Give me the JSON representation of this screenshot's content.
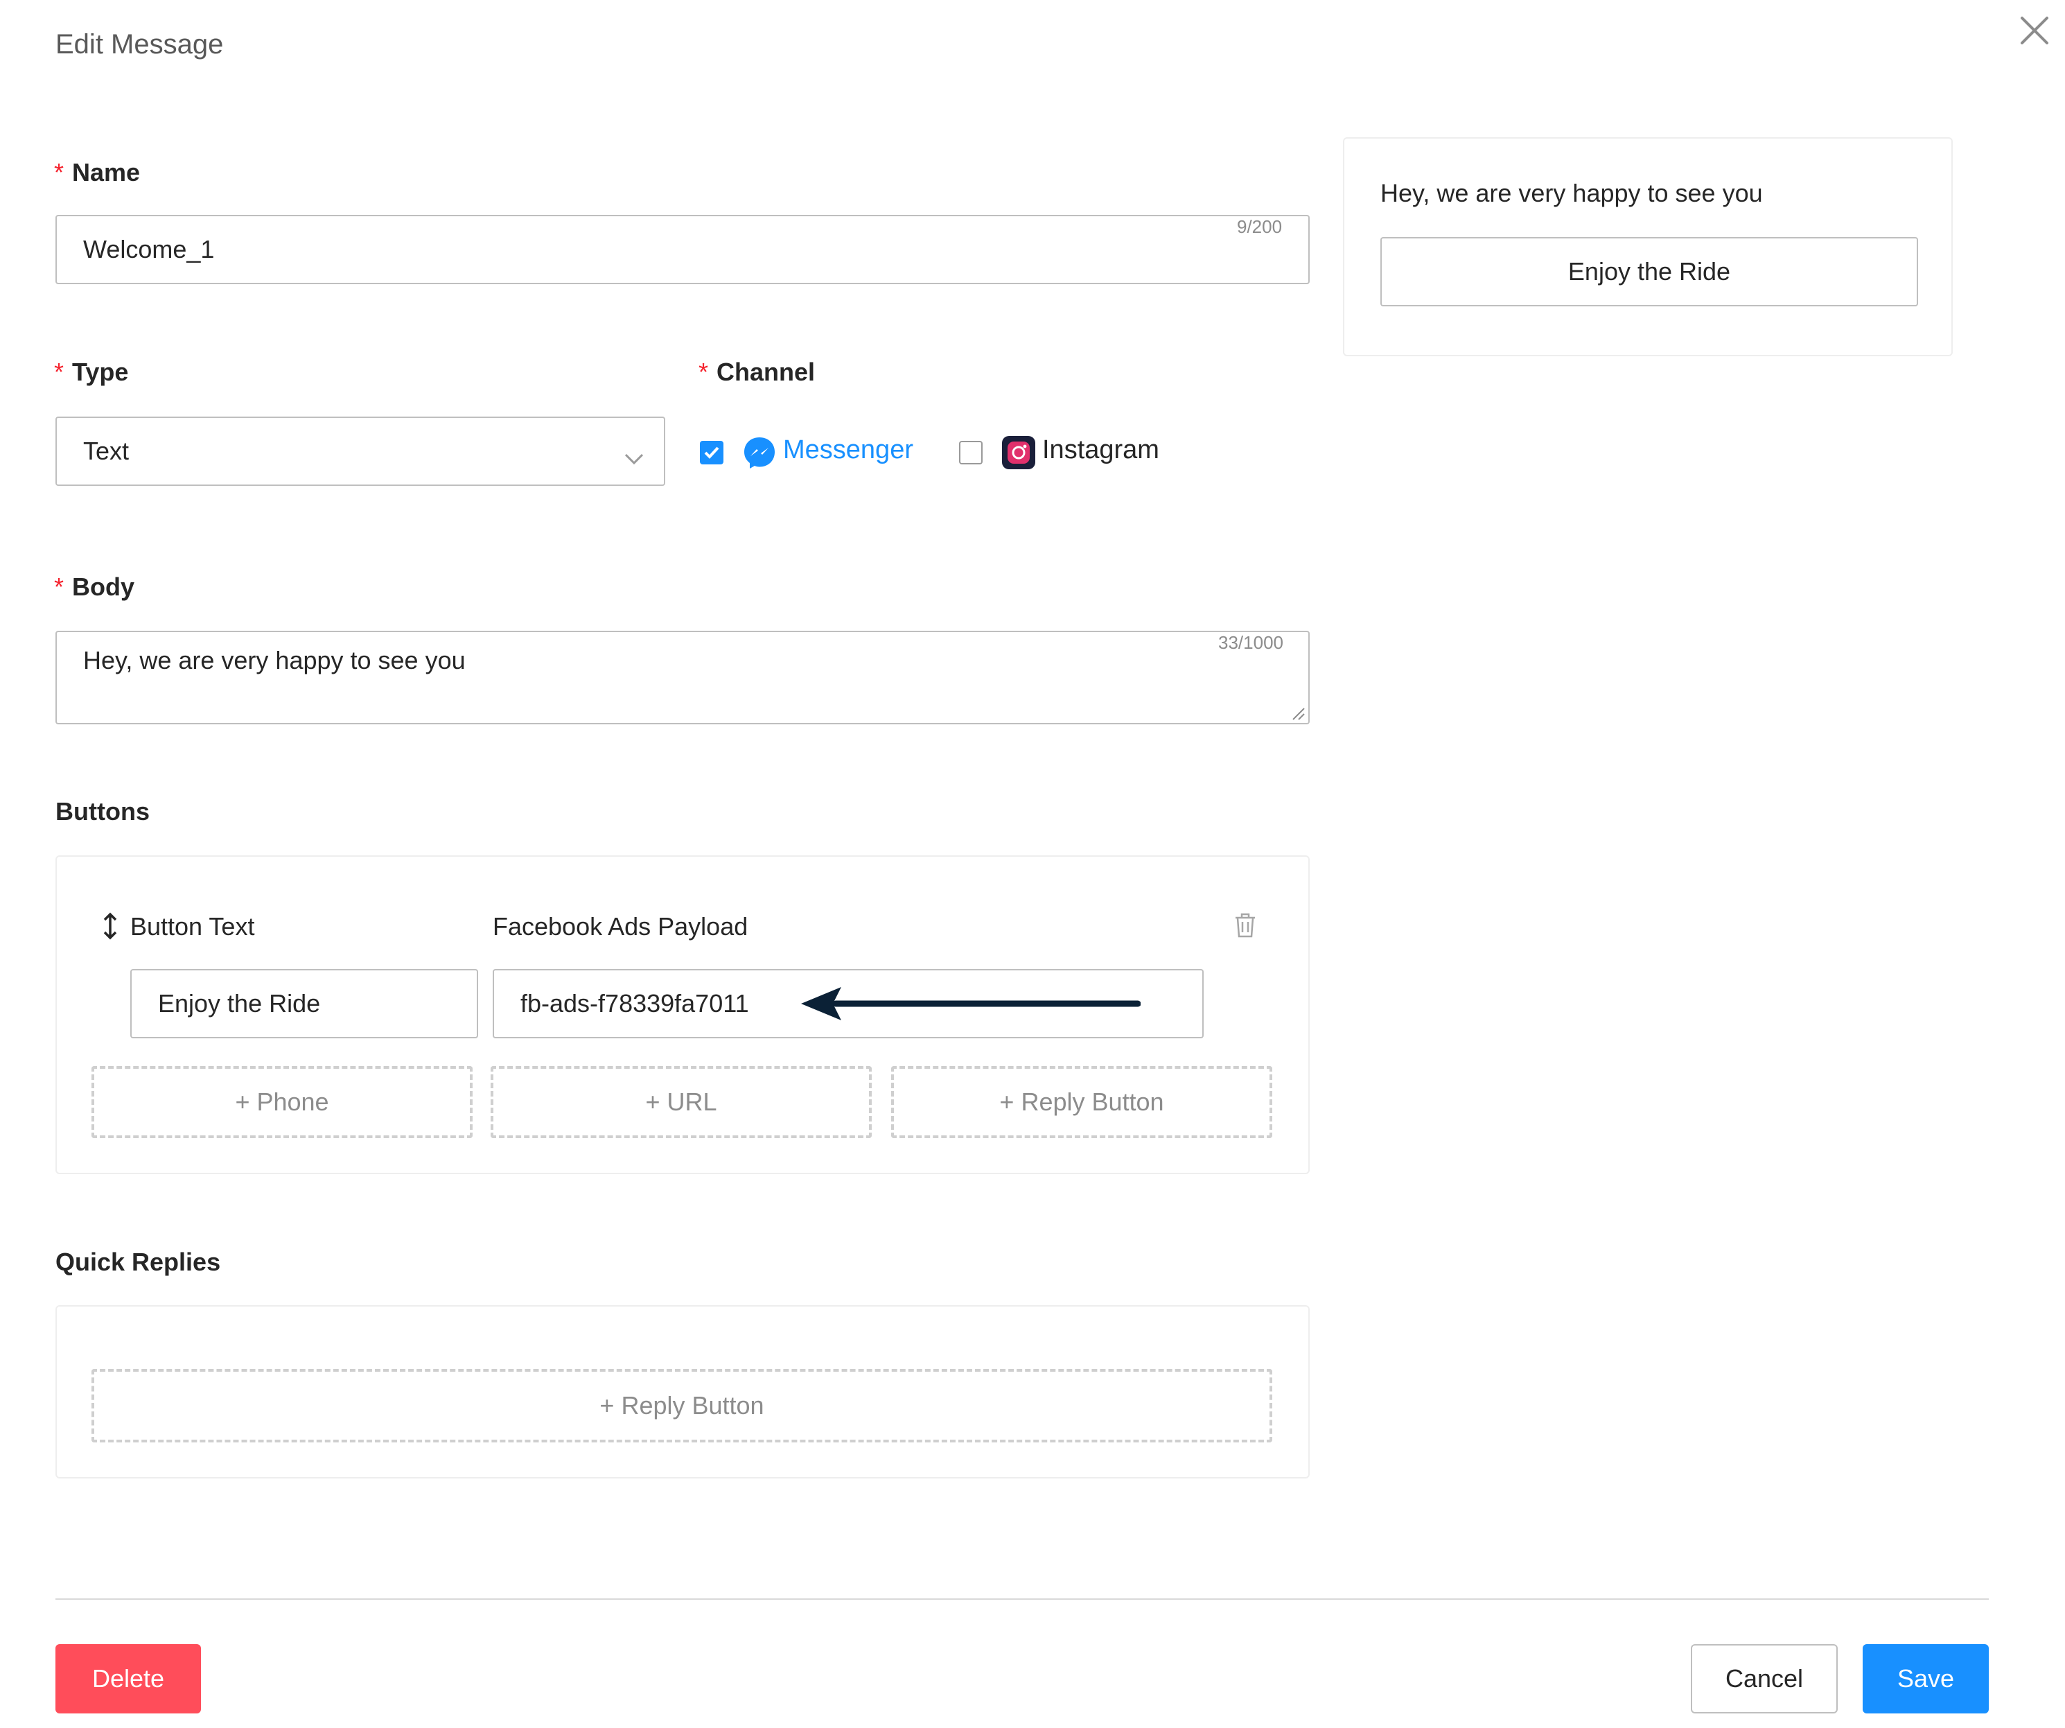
{
  "modal": {
    "title": "Edit Message"
  },
  "name": {
    "label": "Name",
    "value": "Welcome_1",
    "counter": "9/200"
  },
  "type": {
    "label": "Type",
    "value": "Text"
  },
  "channel": {
    "label": "Channel",
    "options": [
      {
        "label": "Messenger",
        "checked": true
      },
      {
        "label": "Instagram",
        "checked": false
      }
    ]
  },
  "body": {
    "label": "Body",
    "value": "Hey, we are very happy to see you",
    "counter": "33/1000"
  },
  "buttons": {
    "heading": "Buttons",
    "col_button_text": "Button Text",
    "col_payload": "Facebook Ads Payload",
    "row": {
      "button_text": "Enjoy the Ride",
      "payload": "fb-ads-f78339fa7011"
    },
    "add_phone": "+ Phone",
    "add_url": "+ URL",
    "add_reply": "+ Reply Button"
  },
  "quick_replies": {
    "heading": "Quick Replies",
    "add_reply": "+ Reply Button"
  },
  "preview": {
    "message": "Hey, we are very happy to see you",
    "button": "Enjoy the Ride"
  },
  "footer": {
    "delete": "Delete",
    "cancel": "Cancel",
    "save": "Save"
  },
  "colors": {
    "accent": "#1890ff",
    "danger": "#ff4d5a",
    "required": "#f5222d",
    "arrow": "#0b2136"
  }
}
